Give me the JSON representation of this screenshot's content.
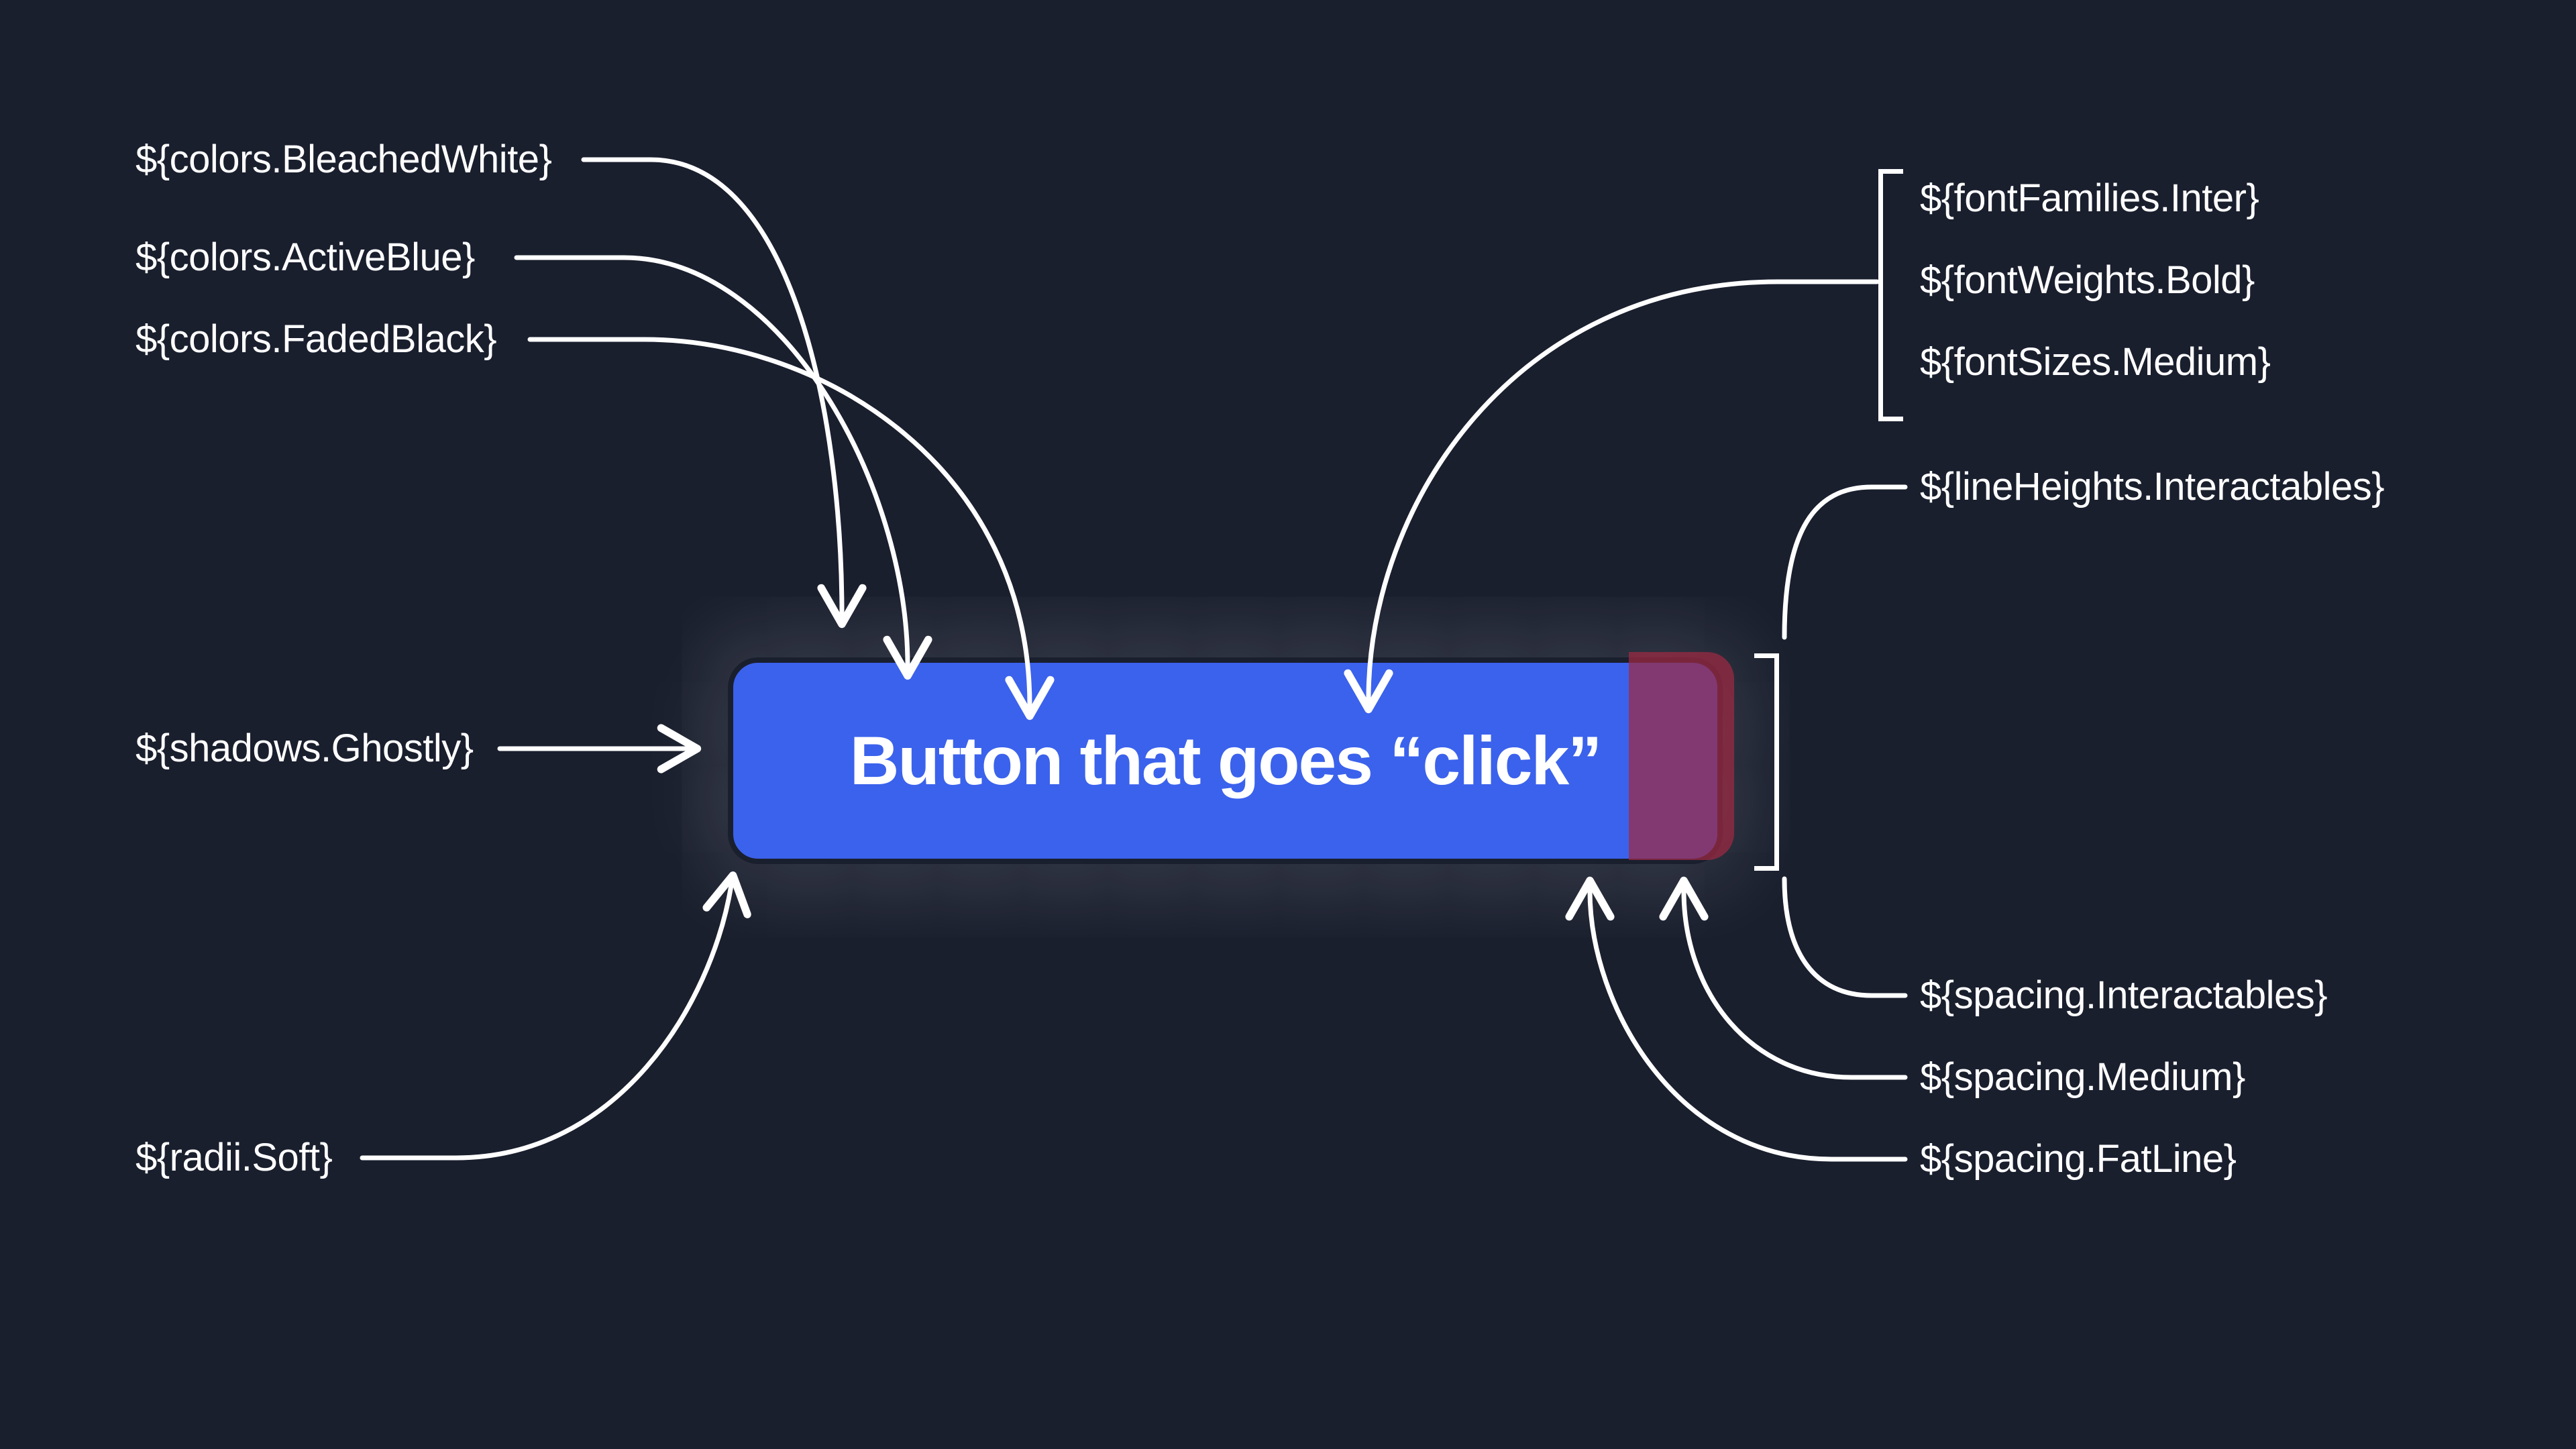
{
  "button": {
    "label": "Button that goes “click”"
  },
  "labels": {
    "bleachedWhite": "${colors.BleachedWhite}",
    "activeBlue": "${colors.ActiveBlue}",
    "fadedBlack": "${colors.FadedBlack}",
    "shadowsGhostly": "${shadows.Ghostly}",
    "radiiSoft": "${radii.Soft}",
    "fontFamiliesInter": "${fontFamilies.Inter}",
    "fontWeightsBold": "${fontWeights.Bold}",
    "fontSizesMedium": "${fontSizes.Medium}",
    "lineHeightsInteractables": "${lineHeights.Interactables}",
    "spacingInteractables": "${spacing.Interactables}",
    "spacingMedium": "${spacing.Medium}",
    "spacingFatLine": "${spacing.FatLine}"
  },
  "colors": {
    "background": "#1a1f2e",
    "buttonFill": "#3b62ec",
    "overlay": "#9e2a43",
    "line": "#ffffff",
    "text": "#ffffff"
  }
}
